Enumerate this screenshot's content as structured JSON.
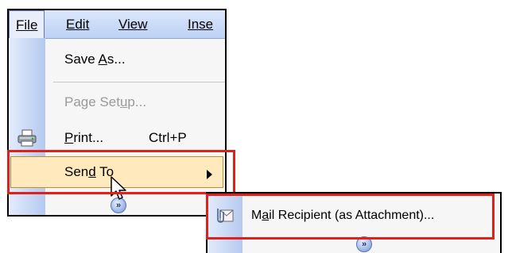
{
  "menubar": {
    "items": [
      {
        "label": "File",
        "accel_index": 0
      },
      {
        "label": "Edit",
        "accel_index": 0
      },
      {
        "label": "View",
        "accel_index": 0
      },
      {
        "label": "Inse",
        "accel_index": 0
      }
    ]
  },
  "file_menu": {
    "save_as": {
      "pre": "Save ",
      "accel": "A",
      "post": "s..."
    },
    "page_setup": {
      "pre": "Page Set",
      "accel": "u",
      "post": "p..."
    },
    "print": {
      "pre": "",
      "accel": "P",
      "post": "rint...",
      "shortcut": "Ctrl+P"
    },
    "send_to": {
      "pre": "Sen",
      "accel": "d",
      "post": " To"
    },
    "expand_glyph": "»"
  },
  "submenu": {
    "mail_recipient": {
      "pre": "M",
      "accel": "a",
      "post": "il Recipient (as Attachment)..."
    },
    "expand_glyph": "»"
  },
  "icons": [
    "printer-icon",
    "mail-attachment-icon",
    "submenu-arrow-icon",
    "expand-chevron-icon",
    "mouse-cursor-icon"
  ],
  "colors": {
    "highlight_frame": "#e0201b",
    "hover_fill": "#ffe9bd",
    "icon_strip": "#b5c9ef",
    "menubar": "#c9daf6"
  }
}
